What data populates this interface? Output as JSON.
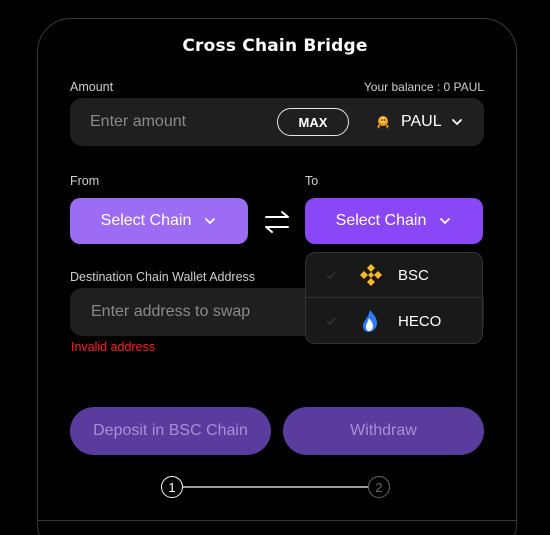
{
  "title": "Cross Chain Bridge",
  "amount": {
    "label": "Amount",
    "balance_text": "Your balance : 0 PAUL",
    "placeholder": "Enter amount",
    "max_label": "MAX",
    "token": "PAUL",
    "token_icon": "paul-token-icon"
  },
  "from": {
    "label": "From",
    "button_label": "Select Chain"
  },
  "to": {
    "label": "To",
    "button_label": "Select Chain"
  },
  "chain_options": [
    {
      "label": "BSC",
      "icon": "bsc-logo-icon",
      "color": "#f3ba2f"
    },
    {
      "label": "HECO",
      "icon": "heco-logo-icon",
      "color": "#2e7bf6"
    }
  ],
  "destination": {
    "label": "Destination Chain Wallet Address",
    "placeholder": "Enter address to swap",
    "error": "Invalid address"
  },
  "actions": {
    "deposit": "Deposit in BSC Chain",
    "withdraw": "Withdraw"
  },
  "steps": [
    "1",
    "2"
  ],
  "colors": {
    "from_button": "#9c6cf5",
    "to_button": "#8a47f8",
    "action_disabled": "#5a3c9e",
    "error": "#ff1f1f"
  }
}
